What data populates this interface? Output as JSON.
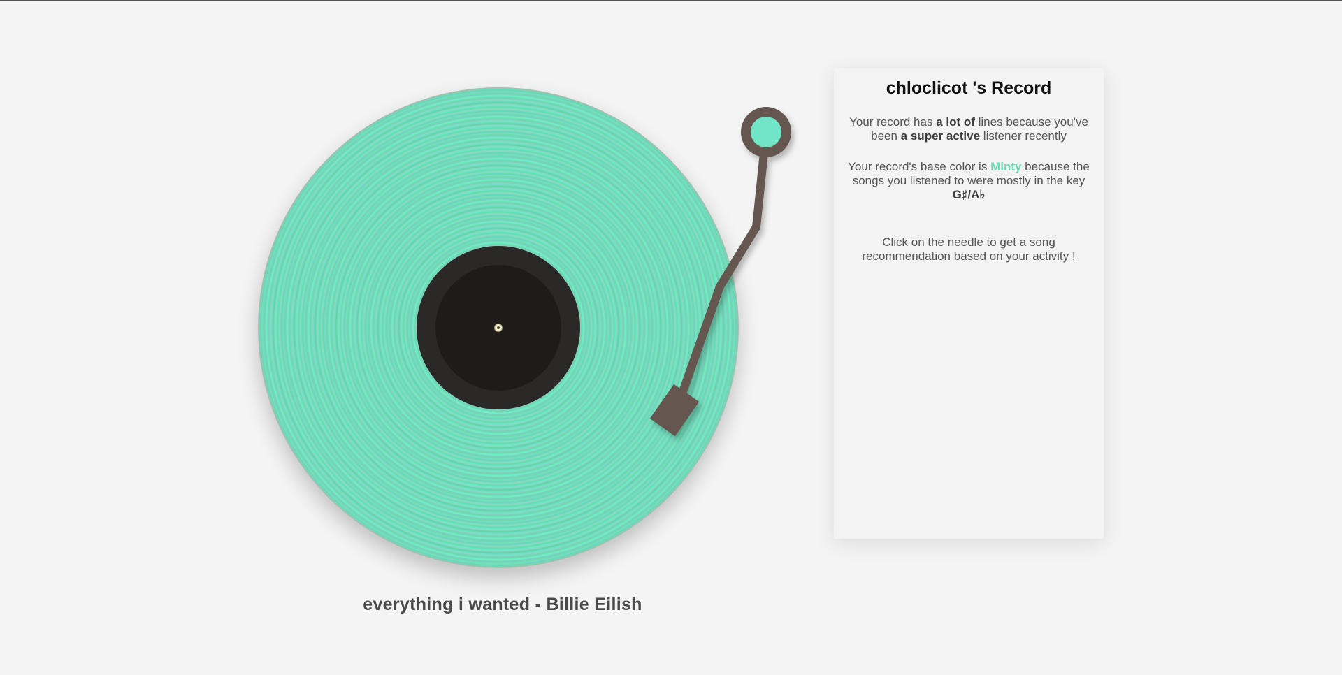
{
  "record": {
    "base_color": "#62e3b4",
    "label_color": "#1d1c1b",
    "tonearm_color": "#655650",
    "tonearm_knob_color": "#6fe6c6"
  },
  "song": {
    "title": "everything i wanted - Billie Eilish"
  },
  "panel": {
    "title": "chloclicot 's Record",
    "p1": {
      "pre": "Your record has ",
      "bold1": "a lot of",
      "mid": " lines because you've been ",
      "bold2": "a super active",
      "post": " listener recently"
    },
    "p2": {
      "pre": "Your record's base color is ",
      "color_name": "Minty",
      "mid": " because the songs you listened to were mostly in the key ",
      "key": "G♯/A♭"
    },
    "p3": {
      "text": "Click on the needle to get a song recommendation based on your activity !"
    }
  }
}
